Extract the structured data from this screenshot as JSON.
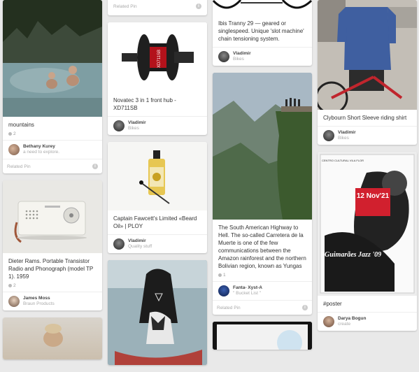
{
  "pins": {
    "mountains": {
      "description": "mountains",
      "repins": "2",
      "pinner": "Bethany Kurey",
      "board": "a need to explore.",
      "related": "Related Pin"
    },
    "radio": {
      "description": "Dieter Rams. Portable Transistor Radio and Phonograph (model TP 1). 1959",
      "repins": "2",
      "pinner": "James Moss",
      "board": "Braun Products"
    },
    "top_related": {
      "related": "Related Pin"
    },
    "hub": {
      "description": "Novatec 3 in 1 front hub - XD711SB",
      "pinner": "Vladimir",
      "board": "Bikes",
      "product_text": "XD711SB"
    },
    "oil": {
      "description": "Captain Fawcett's Limited «Beard Oil» | PLOY",
      "pinner": "Vladimir",
      "board": "Quality stuff"
    },
    "ibis": {
      "description": "Ibis Tranny 29 — geared or singlespeed. Unique 'slot machine' chain tensioning system.",
      "pinner": "Vladimir",
      "board": "Bikes"
    },
    "highway": {
      "description": "The South American Highway to Hell. The so-called Carretera de la Muerte is one of the few communications between the Amazon rainforest and the northern Bolivian region, known as Yungas",
      "repins": "1",
      "pinner": "Fanta- Xyst-A",
      "board": "\" Bucket List \"",
      "related": "Related Pin"
    },
    "shirt": {
      "description": "Clybourn Short Sleeve riding shirt",
      "pinner": "Vladimir",
      "board": "Bikes"
    },
    "poster": {
      "description": "#poster",
      "pinner": "Darya Bogun",
      "board": "create",
      "poster_date": "12 Nov'21",
      "poster_title": "Guimarães Jazz '09",
      "poster_header": "CENTRO CULTURAL VILA FLOR"
    }
  },
  "info_icon_glyph": "i",
  "colors": {
    "background": "#e9e9e9",
    "card": "#ffffff",
    "muted_text": "#999999"
  }
}
